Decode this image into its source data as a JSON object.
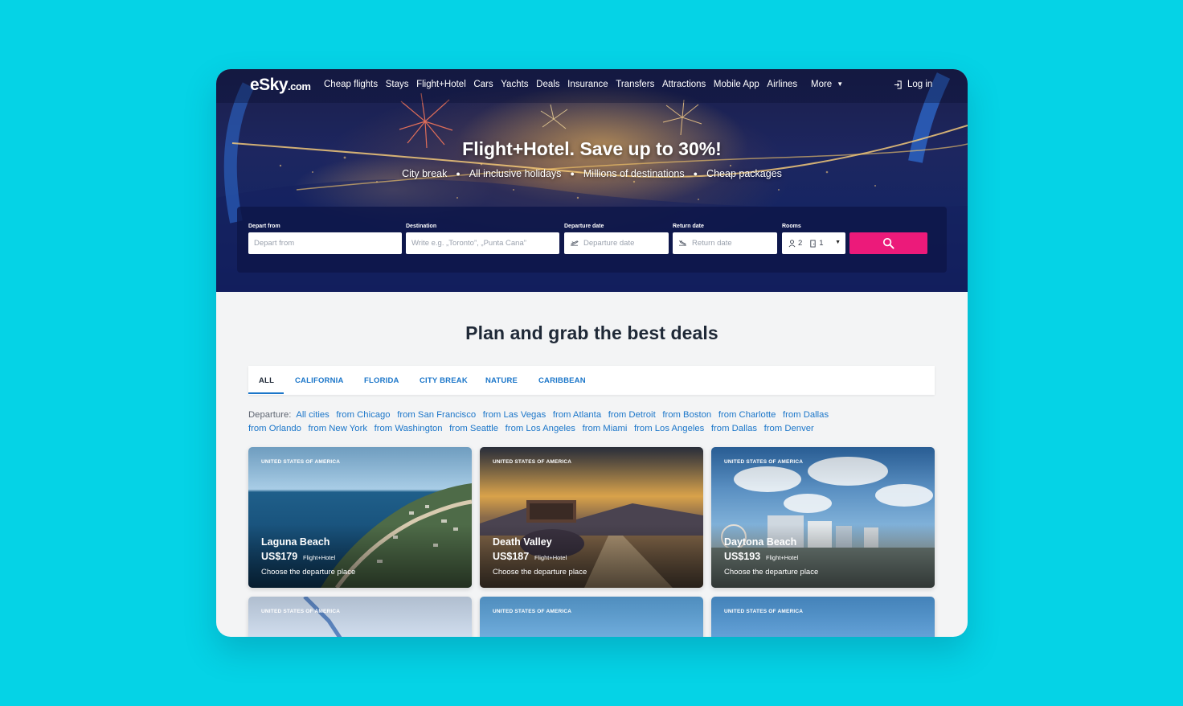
{
  "header": {
    "logo_main": "eSky",
    "logo_suffix": ".com",
    "nav": [
      "Cheap flights",
      "Stays",
      "Flight+Hotel",
      "Cars",
      "Yachts",
      "Deals",
      "Insurance",
      "Transfers",
      "Attractions",
      "Mobile App",
      "Airlines"
    ],
    "more_label": "More",
    "login_label": "Log in"
  },
  "hero": {
    "title": "Flight+Hotel. Save up to 30%!",
    "features": [
      "City break",
      "All inclusive holidays",
      "Millions of destinations",
      "Cheap packages"
    ]
  },
  "search": {
    "depart_label": "Depart from",
    "depart_placeholder": "Depart from",
    "destination_label": "Destination",
    "destination_placeholder": "Write e.g. „Toronto”, „Punta Cana”",
    "departure_date_label": "Departure date",
    "departure_date_placeholder": "Departure date",
    "return_date_label": "Return date",
    "return_date_placeholder": "Return date",
    "rooms_label": "Rooms",
    "adults": "2",
    "rooms": "1",
    "button_color": "#ec1a7a"
  },
  "deals": {
    "title": "Plan and grab the best deals",
    "tabs": [
      "ALL",
      "CALIFORNIA",
      "FLORIDA",
      "CITY BREAK",
      "NATURE",
      "CARIBBEAN"
    ],
    "active_tab": "ALL",
    "departure_label": "Departure:",
    "departures_row1": [
      "All cities",
      "from Chicago",
      "from San Francisco",
      "from Las Vegas",
      "from Atlanta",
      "from Detroit",
      "from Boston",
      "from Charlotte",
      "from Dallas"
    ],
    "departures_row2": [
      "from Orlando",
      "from New York",
      "from Washington",
      "from Seattle",
      "from Los Angeles",
      "from Miami",
      "from Los Angeles",
      "from Dallas",
      "from Denver"
    ],
    "cards": [
      {
        "country": "UNITED STATES OF AMERICA",
        "name": "Laguna Beach",
        "price": "US$179",
        "type": "Flight+Hotel",
        "cta": "Choose the departure place"
      },
      {
        "country": "UNITED STATES OF AMERICA",
        "name": "Death Valley",
        "price": "US$187",
        "type": "Flight+Hotel",
        "cta": "Choose the departure place"
      },
      {
        "country": "UNITED STATES OF AMERICA",
        "name": "Daytona Beach",
        "price": "US$193",
        "type": "Flight+Hotel",
        "cta": "Choose the departure place"
      },
      {
        "country": "UNITED STATES OF AMERICA"
      },
      {
        "country": "UNITED STATES OF AMERICA"
      },
      {
        "country": "UNITED STATES OF AMERICA"
      }
    ]
  },
  "colors": {
    "page_background": "#05d3e6",
    "link": "#1b76c9",
    "accent": "#ec1a7a"
  }
}
